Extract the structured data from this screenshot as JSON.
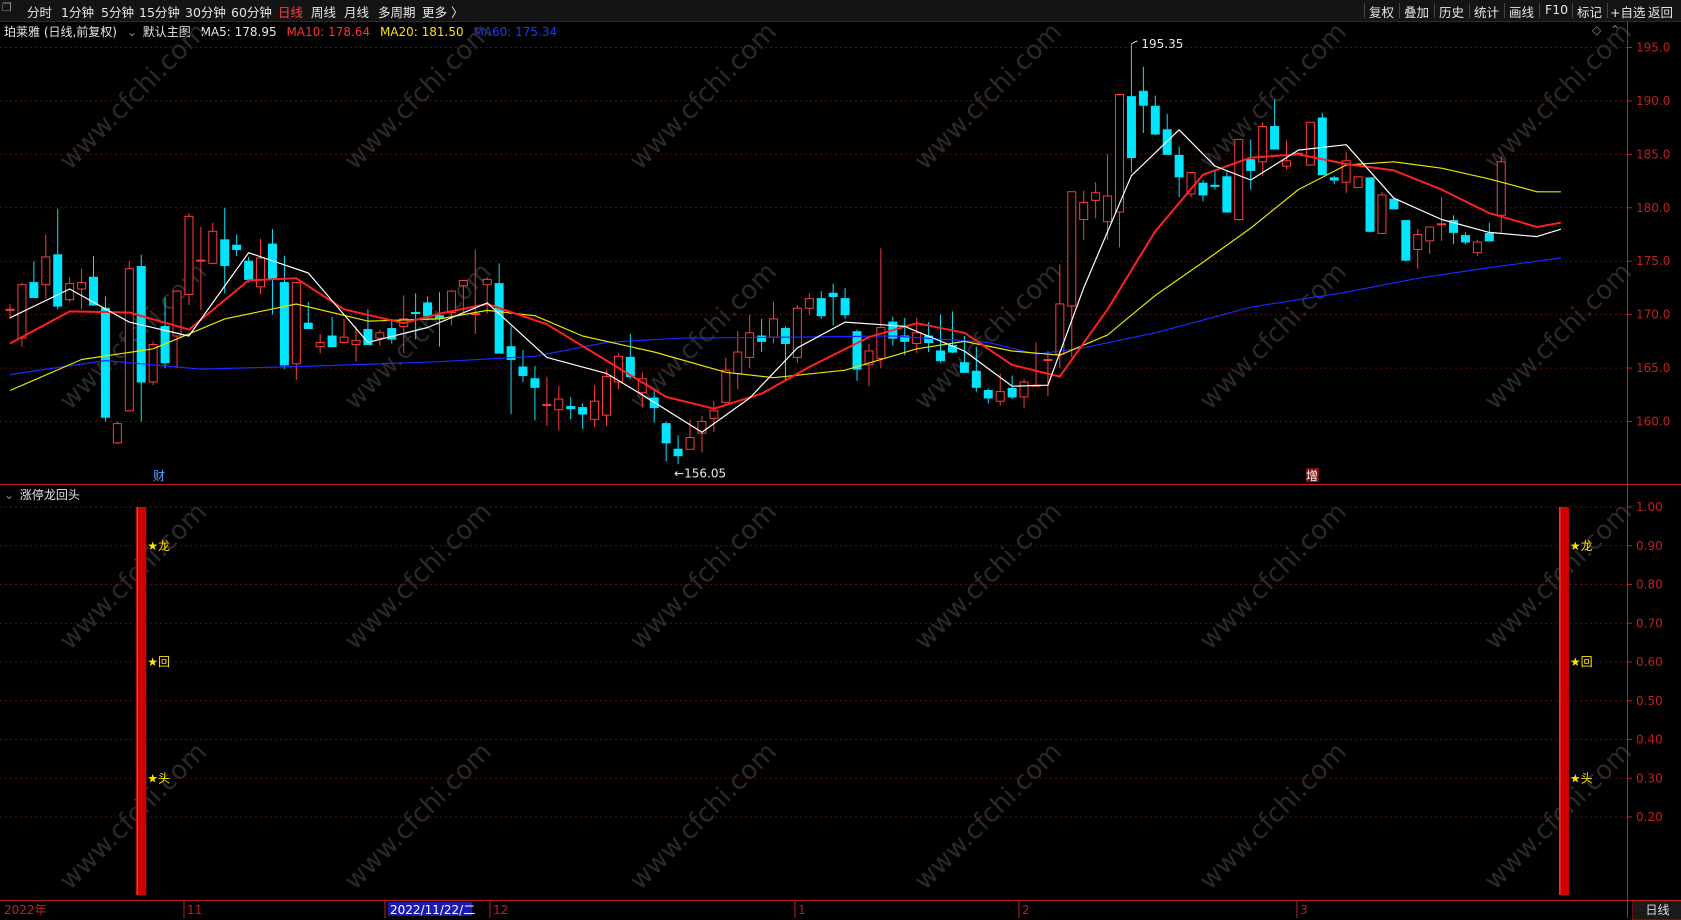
{
  "toolbar": {
    "left_items": [
      "分时",
      "1分钟",
      "5分钟",
      "15分钟",
      "30分钟",
      "60分钟",
      "日线",
      "周线",
      "月线",
      "多周期",
      "更多 〉"
    ],
    "active": "日线",
    "right_items": [
      "复权",
      "叠加",
      "历史",
      "统计",
      "画线",
      "F10",
      "标记",
      "+自选",
      "返回"
    ]
  },
  "main_legend": {
    "stock": "珀莱雅 (日线,前复权)",
    "template": "默认主图",
    "ma5": "MA5: 178.95",
    "ma10": "MA10: 178.64",
    "ma20": "MA20: 181.50",
    "ma60": "MA60: 175.34"
  },
  "colors": {
    "up": "#ff3b3b",
    "down": "#00e5ff",
    "ma5": "#ffffff",
    "ma10": "#ff2020",
    "ma20": "#e6e600",
    "ma60": "#1a2aff",
    "axis": "#c41e1e",
    "grid": "#5a1010",
    "star_text": "#ffe400",
    "signal_bar": "#d00000"
  },
  "price_axis": {
    "ticks": [
      "195.0",
      "190.0",
      "185.0",
      "180.0",
      "175.0",
      "170.0",
      "165.0",
      "160.0"
    ]
  },
  "annotations": {
    "high": "195.35",
    "low": "156.05",
    "event_cai": "财",
    "event_zeng": "增"
  },
  "indicator": {
    "title": "涨停龙回头",
    "ticks": [
      "1.00",
      "0.90",
      "0.80",
      "0.70",
      "0.60",
      "0.50",
      "0.40",
      "0.30",
      "0.20"
    ],
    "labels": [
      "★龙",
      "★回",
      "★头"
    ]
  },
  "time_axis": {
    "year": "2022年",
    "labels": [
      "11",
      "2022/11/22/二",
      "12",
      "1",
      "2",
      "3"
    ]
  },
  "bottom_tab": "日线",
  "chart_data": {
    "type": "candlestick",
    "title": "珀莱雅 (日线,前复权)",
    "ylim": [
      155,
      196.5
    ],
    "yticks": [
      160,
      165,
      170,
      175,
      180,
      185,
      190,
      195
    ],
    "candles": [
      [
        170.5,
        171.0,
        169.6,
        170.5
      ],
      [
        167.8,
        173.0,
        167.0,
        172.8
      ],
      [
        173.0,
        175.0,
        171.6,
        171.6
      ],
      [
        172.8,
        177.5,
        171.5,
        175.4
      ],
      [
        175.6,
        179.9,
        170.5,
        170.8
      ],
      [
        171.4,
        173.5,
        171.2,
        172.9
      ],
      [
        172.4,
        174.3,
        170.5,
        173.0
      ],
      [
        173.5,
        175.5,
        171.0,
        170.9
      ],
      [
        170.6,
        171.7,
        160.0,
        160.4
      ],
      [
        158.0,
        160.0,
        157.9,
        159.8
      ],
      [
        161.0,
        175.0,
        161.0,
        174.3
      ],
      [
        174.5,
        175.6,
        160.0,
        163.7
      ],
      [
        163.7,
        167.5,
        163.4,
        167.2
      ],
      [
        168.9,
        171.6,
        165.0,
        165.5
      ],
      [
        168.0,
        172.3,
        165.0,
        172.2
      ],
      [
        171.9,
        179.5,
        170.9,
        179.2
      ],
      [
        175.1,
        178.2,
        170.4,
        175.1
      ],
      [
        174.8,
        178.6,
        174.7,
        177.8
      ],
      [
        177.0,
        180.0,
        172.0,
        174.6
      ],
      [
        176.5,
        177.5,
        175.5,
        176.1
      ],
      [
        175.0,
        175.4,
        173.0,
        173.3
      ],
      [
        172.6,
        177.1,
        171.9,
        175.3
      ],
      [
        176.6,
        178.0,
        170.0,
        173.3
      ],
      [
        173.0,
        175.5,
        164.9,
        165.3
      ],
      [
        165.4,
        173.0,
        163.9,
        173.0
      ],
      [
        169.2,
        171.2,
        168.9,
        168.7
      ],
      [
        167.0,
        168.2,
        166.4,
        167.4
      ],
      [
        168.0,
        169.8,
        167.2,
        167.0
      ],
      [
        167.4,
        169.6,
        167.3,
        167.9
      ],
      [
        167.2,
        168.9,
        165.6,
        167.6
      ],
      [
        168.6,
        170.5,
        167.4,
        167.2
      ],
      [
        167.8,
        168.6,
        167.1,
        168.3
      ],
      [
        168.7,
        169.6,
        167.3,
        167.7
      ],
      [
        168.9,
        171.8,
        166.4,
        169.6
      ],
      [
        170.2,
        172.0,
        167.7,
        170.1
      ],
      [
        171.1,
        171.7,
        169.5,
        169.9
      ],
      [
        169.9,
        172.1,
        167.0,
        169.7
      ],
      [
        170.2,
        172.3,
        169.0,
        172.2
      ],
      [
        172.7,
        173.0,
        170.2,
        173.2
      ],
      [
        170.1,
        176.1,
        168.2,
        170.1
      ],
      [
        172.8,
        173.5,
        170.1,
        173.3
      ],
      [
        172.9,
        174.8,
        166.6,
        166.4
      ],
      [
        167.0,
        168.9,
        160.7,
        165.8
      ],
      [
        165.1,
        166.7,
        163.7,
        164.3
      ],
      [
        164.0,
        165.2,
        160.1,
        163.2
      ],
      [
        161.5,
        164.2,
        159.6,
        161.6
      ],
      [
        161.1,
        163.3,
        159.2,
        162.1
      ],
      [
        161.4,
        162.3,
        160.2,
        161.2
      ],
      [
        161.3,
        161.7,
        159.3,
        160.7
      ],
      [
        160.2,
        163.4,
        159.5,
        161.9
      ],
      [
        160.6,
        164.8,
        159.6,
        164.2
      ],
      [
        163.7,
        166.4,
        163.0,
        166.1
      ],
      [
        166.0,
        168.2,
        164.0,
        164.2
      ],
      [
        162.7,
        164.6,
        161.3,
        164.0
      ],
      [
        162.2,
        162.9,
        159.9,
        161.3
      ],
      [
        159.8,
        160.0,
        156.3,
        158.0
      ],
      [
        157.4,
        158.7,
        156.0,
        156.8
      ],
      [
        157.4,
        160.2,
        157.5,
        158.5
      ],
      [
        158.9,
        160.5,
        157.1,
        160.0
      ],
      [
        160.3,
        161.9,
        159.0,
        161.0
      ],
      [
        161.8,
        166.0,
        161.5,
        164.8
      ],
      [
        164.5,
        168.5,
        163.0,
        166.5
      ],
      [
        166.0,
        170.0,
        165.0,
        168.3
      ],
      [
        168.0,
        169.6,
        166.5,
        167.5
      ],
      [
        167.9,
        171.2,
        167.3,
        169.6
      ],
      [
        168.7,
        168.9,
        163.8,
        167.3
      ],
      [
        166.0,
        170.9,
        165.5,
        170.6
      ],
      [
        170.6,
        172.0,
        170.0,
        171.5
      ],
      [
        171.5,
        172.2,
        169.6,
        169.9
      ],
      [
        172.0,
        172.9,
        169.0,
        171.7
      ],
      [
        171.5,
        172.5,
        169.6,
        170.0
      ],
      [
        168.4,
        168.6,
        163.8,
        164.9
      ],
      [
        165.3,
        167.3,
        163.3,
        166.6
      ],
      [
        165.9,
        176.2,
        165.0,
        168.8
      ],
      [
        169.3,
        169.8,
        167.1,
        167.8
      ],
      [
        168.0,
        169.7,
        166.2,
        167.5
      ],
      [
        167.3,
        169.7,
        166.4,
        168.3
      ],
      [
        168.0,
        169.3,
        166.5,
        167.4
      ],
      [
        166.6,
        170.0,
        165.5,
        165.7
      ],
      [
        167.1,
        170.3,
        166.4,
        166.5
      ],
      [
        165.5,
        168.0,
        164.7,
        164.6
      ],
      [
        164.7,
        167.0,
        162.8,
        163.2
      ],
      [
        162.9,
        163.1,
        161.7,
        162.2
      ],
      [
        161.9,
        164.5,
        161.5,
        162.8
      ],
      [
        163.1,
        164.3,
        162.1,
        162.3
      ],
      [
        162.3,
        164.0,
        161.3,
        163.7
      ],
      [
        163.4,
        167.4,
        163.4,
        163.4
      ],
      [
        165.8,
        166.6,
        162.4,
        165.8
      ],
      [
        166.3,
        174.7,
        165.0,
        171.0
      ],
      [
        170.8,
        181.3,
        166.0,
        181.5
      ],
      [
        178.9,
        181.6,
        177.0,
        180.5
      ],
      [
        180.7,
        182.4,
        179.0,
        181.4
      ],
      [
        178.7,
        185.0,
        177.0,
        181.1
      ],
      [
        179.6,
        190.6,
        176.3,
        190.6
      ],
      [
        190.4,
        195.3,
        183.3,
        184.7
      ],
      [
        190.9,
        193.2,
        187.0,
        189.6
      ],
      [
        189.5,
        190.5,
        186.8,
        186.9
      ],
      [
        187.3,
        188.8,
        185.0,
        185.0
      ],
      [
        184.9,
        185.7,
        181.0,
        182.9
      ],
      [
        181.3,
        182.5,
        181.0,
        183.3
      ],
      [
        182.3,
        182.6,
        180.6,
        181.2
      ],
      [
        182.1,
        183.5,
        181.7,
        182.0
      ],
      [
        182.9,
        183.5,
        179.8,
        179.6
      ],
      [
        178.9,
        185.3,
        178.8,
        186.4
      ],
      [
        184.5,
        186.4,
        181.7,
        183.5
      ],
      [
        184.3,
        188.0,
        183.0,
        187.6
      ],
      [
        187.6,
        190.1,
        185.5,
        185.5
      ],
      [
        183.9,
        186.3,
        183.6,
        184.4
      ],
      [
        185.1,
        185.2,
        185.0,
        185.1
      ],
      [
        184.0,
        185.7,
        184.6,
        188.0
      ],
      [
        188.4,
        188.9,
        185.0,
        183.1
      ],
      [
        182.8,
        183.0,
        182.2,
        182.6
      ],
      [
        182.4,
        185.2,
        181.4,
        184.4
      ],
      [
        181.9,
        182.8,
        182.0,
        182.9
      ],
      [
        182.8,
        182.5,
        177.7,
        177.8
      ],
      [
        177.6,
        181.5,
        177.6,
        181.2
      ],
      [
        180.8,
        181.0,
        180.1,
        179.9
      ],
      [
        178.8,
        178.7,
        175.0,
        175.1
      ],
      [
        176.1,
        178.0,
        174.3,
        177.5
      ],
      [
        176.9,
        178.2,
        175.7,
        178.2
      ],
      [
        178.5,
        181.0,
        176.9,
        178.5
      ],
      [
        178.8,
        179.3,
        176.6,
        177.7
      ],
      [
        177.4,
        177.7,
        176.6,
        176.8
      ],
      [
        175.8,
        177.0,
        175.5,
        176.8
      ],
      [
        177.6,
        178.6,
        177.0,
        176.9
      ],
      [
        179.3,
        184.8,
        177.6,
        184.3
      ]
    ],
    "ma5": [
      [
        0,
        169.7
      ],
      [
        5,
        172.4
      ],
      [
        10,
        169.3
      ],
      [
        15,
        168.0
      ],
      [
        20,
        175.8
      ],
      [
        25,
        173.9
      ],
      [
        30,
        167.4
      ],
      [
        35,
        168.8
      ],
      [
        40,
        171.1
      ],
      [
        45,
        166.0
      ],
      [
        50,
        164.5
      ],
      [
        53,
        162.5
      ],
      [
        58,
        159.0
      ],
      [
        62,
        162.2
      ],
      [
        66,
        166.9
      ],
      [
        70,
        169.3
      ],
      [
        75,
        168.9
      ],
      [
        80,
        166.6
      ],
      [
        84,
        163.3
      ],
      [
        87,
        163.4
      ],
      [
        90,
        172.5
      ],
      [
        94,
        183.0
      ],
      [
        98,
        187.3
      ],
      [
        101,
        183.9
      ],
      [
        104,
        182.6
      ],
      [
        108,
        185.4
      ],
      [
        112,
        185.9
      ],
      [
        116,
        180.9
      ],
      [
        120,
        178.9
      ],
      [
        124,
        177.7
      ],
      [
        128,
        177.3
      ],
      [
        130,
        178.0
      ]
    ],
    "ma10": [
      [
        0,
        167.3
      ],
      [
        5,
        170.3
      ],
      [
        10,
        170.2
      ],
      [
        15,
        168.6
      ],
      [
        20,
        173.2
      ],
      [
        24,
        173.4
      ],
      [
        28,
        170.5
      ],
      [
        33,
        169.2
      ],
      [
        36,
        170.1
      ],
      [
        40,
        171.0
      ],
      [
        45,
        169.1
      ],
      [
        50,
        165.7
      ],
      [
        55,
        162.3
      ],
      [
        59,
        161.2
      ],
      [
        63,
        162.6
      ],
      [
        67,
        165.1
      ],
      [
        72,
        167.9
      ],
      [
        76,
        169.2
      ],
      [
        80,
        168.3
      ],
      [
        84,
        165.3
      ],
      [
        88,
        164.2
      ],
      [
        92,
        170.5
      ],
      [
        96,
        177.8
      ],
      [
        100,
        183.1
      ],
      [
        104,
        184.7
      ],
      [
        108,
        185.0
      ],
      [
        112,
        184.1
      ],
      [
        116,
        183.5
      ],
      [
        120,
        181.7
      ],
      [
        124,
        179.5
      ],
      [
        128,
        178.2
      ],
      [
        130,
        178.6
      ]
    ],
    "ma20": [
      [
        0,
        162.9
      ],
      [
        6,
        165.8
      ],
      [
        12,
        166.8
      ],
      [
        18,
        169.6
      ],
      [
        24,
        171.0
      ],
      [
        30,
        169.4
      ],
      [
        36,
        169.6
      ],
      [
        40,
        170.4
      ],
      [
        44,
        169.9
      ],
      [
        48,
        168.0
      ],
      [
        54,
        166.5
      ],
      [
        60,
        164.6
      ],
      [
        64,
        164.1
      ],
      [
        70,
        164.8
      ],
      [
        76,
        166.8
      ],
      [
        80,
        167.5
      ],
      [
        84,
        166.6
      ],
      [
        88,
        166.2
      ],
      [
        92,
        168.1
      ],
      [
        96,
        171.8
      ],
      [
        100,
        174.9
      ],
      [
        104,
        178.1
      ],
      [
        108,
        181.7
      ],
      [
        112,
        184.0
      ],
      [
        116,
        184.3
      ],
      [
        120,
        183.7
      ],
      [
        124,
        182.7
      ],
      [
        128,
        181.5
      ],
      [
        130,
        181.5
      ]
    ],
    "ma60": [
      [
        0,
        164.4
      ],
      [
        8,
        165.7
      ],
      [
        16,
        164.9
      ],
      [
        26,
        165.2
      ],
      [
        36,
        165.6
      ],
      [
        44,
        166.1
      ],
      [
        50,
        167.4
      ],
      [
        56,
        167.8
      ],
      [
        66,
        167.9
      ],
      [
        74,
        168.0
      ],
      [
        82,
        167.4
      ],
      [
        86,
        166.3
      ],
      [
        90,
        166.9
      ],
      [
        96,
        168.3
      ],
      [
        104,
        170.7
      ],
      [
        112,
        172.1
      ],
      [
        118,
        173.4
      ],
      [
        124,
        174.4
      ],
      [
        130,
        175.3
      ]
    ],
    "signal_bars": [
      11,
      130
    ],
    "signal_value": 1.0,
    "indicator_ylim": [
      0,
      1.05
    ]
  }
}
